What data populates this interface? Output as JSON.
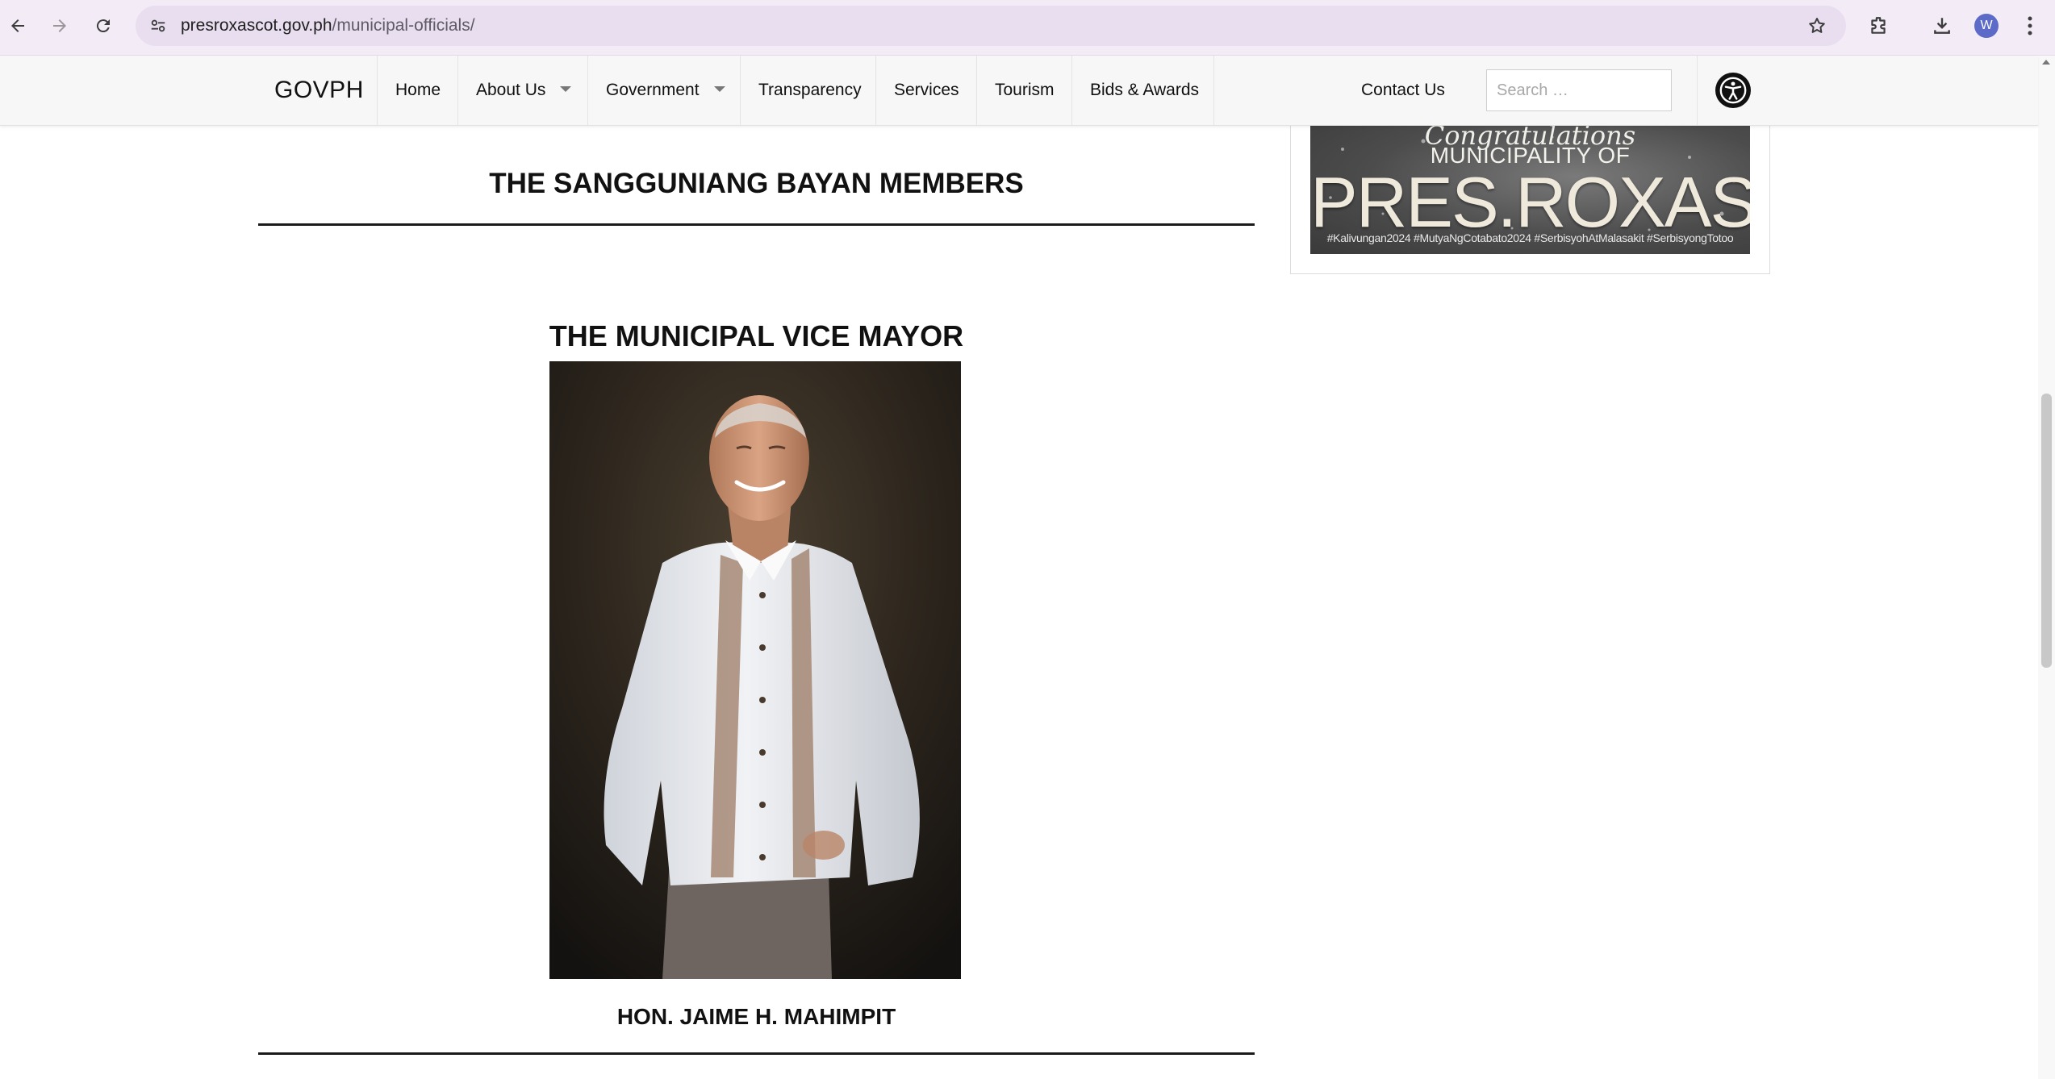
{
  "browser": {
    "url_domain": "presroxascot.gov.ph",
    "url_path": "/municipal-officials/",
    "profile_initial": "W",
    "icons": [
      "back-icon",
      "forward-icon",
      "reload-icon",
      "site-info-icon",
      "star-icon",
      "extensions-icon",
      "download-icon",
      "menu-dots-icon"
    ]
  },
  "site_nav": {
    "brand": "GOVPH",
    "menu": [
      {
        "label": "Home",
        "has_dropdown": false
      },
      {
        "label": "About Us",
        "has_dropdown": true
      },
      {
        "label": "Government",
        "has_dropdown": true
      },
      {
        "label": "Transparency",
        "has_dropdown": false
      },
      {
        "label": "Services",
        "has_dropdown": false
      },
      {
        "label": "Tourism",
        "has_dropdown": false
      },
      {
        "label": "Bids & Awards",
        "has_dropdown": false
      }
    ],
    "contact": "Contact Us",
    "search_placeholder": "Search …",
    "accessibility_icon": "accessibility-icon"
  },
  "content": {
    "sb_heading": "THE SANGGUNIANG BAYAN MEMBERS",
    "vice_mayor_heading": "THE MUNICIPAL VICE MAYOR",
    "vice_mayor_name": "HON. JAIME H. MAHIMPIT"
  },
  "sidebar_banner": {
    "script_text": "Congratulations",
    "line1": "MUNICIPALITY OF",
    "line2": "PRES.ROXAS",
    "hashtags": "#Kalivungan2024 #MutyaNgCotabato2024 #SerbisyohAtMalasakit #SerbisyongTotoo"
  }
}
